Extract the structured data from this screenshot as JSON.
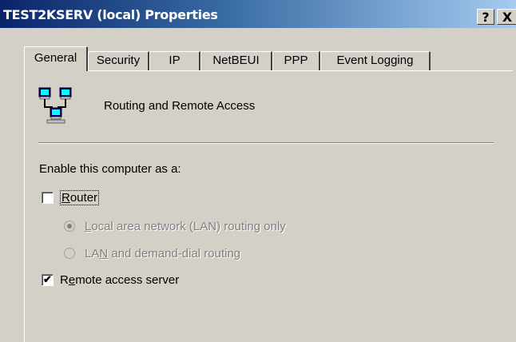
{
  "window": {
    "title": "TEST2KSERV (local) Properties",
    "help_label": "?",
    "close_label": "X"
  },
  "tabs": [
    {
      "label": "General",
      "active": true
    },
    {
      "label": "Security",
      "active": false
    },
    {
      "label": "IP",
      "active": false
    },
    {
      "label": "NetBEUI",
      "active": false
    },
    {
      "label": "PPP",
      "active": false
    },
    {
      "label": "Event Logging",
      "active": false
    }
  ],
  "general": {
    "service_icon": "network-computers-icon",
    "service_name": "Routing and Remote Access",
    "enable_label": "Enable this computer as a:",
    "router": {
      "label_first": "R",
      "label_rest": "outer",
      "checked": false
    },
    "lan_only": {
      "label_first": "L",
      "label_rest": "ocal area network (LAN) routing only",
      "selected": true,
      "enabled": false
    },
    "demand_dial": {
      "label_pre": "LA",
      "label_u": "N",
      "label_rest": " and demand-dial routing",
      "selected": false,
      "enabled": false
    },
    "remote_access": {
      "label_pre": "R",
      "label_u": "e",
      "label_rest": "mote access server",
      "checked": true
    }
  },
  "colors": {
    "dialog_face": "#d4d0c8",
    "title_gradient_start": "#0a246a",
    "title_gradient_end": "#a6caf0",
    "disabled_text": "#808080"
  }
}
